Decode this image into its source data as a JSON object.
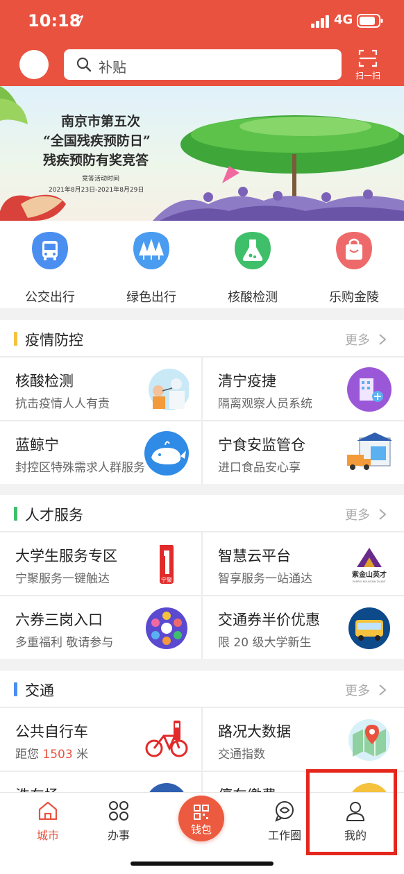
{
  "status_bar": {
    "time": "10:18",
    "network": "4G"
  },
  "search": {
    "placeholder": "补贴"
  },
  "scan": {
    "label": "扫一扫"
  },
  "banner": {
    "line1": "南京市第五次",
    "line2": "“全国残疾预防日”",
    "line3": "残疾预防有奖竞答",
    "line4": "竞答活动时间",
    "line5": "2021年8月23日-2021年8月29日"
  },
  "quick_entries": [
    {
      "label": "公交出行",
      "icon": "bus-icon",
      "color": "#4a8ef0"
    },
    {
      "label": "绿色出行",
      "icon": "trees-icon",
      "color": "#4a9cf0"
    },
    {
      "label": "核酸检测",
      "icon": "flask-icon",
      "color": "#3fbf6a"
    },
    {
      "label": "乐购金陵",
      "icon": "shopping-bag-icon",
      "color": "#ee6a6a"
    }
  ],
  "sections": [
    {
      "title": "疫情防控",
      "more": "更多",
      "bar_color": "#f5c23d",
      "cards": [
        {
          "title": "核酸检测",
          "subtitle": "抗击疫情人人有责",
          "icon": "swab-test-icon"
        },
        {
          "title": "清宁疫捷",
          "subtitle": "隔离观察人员系统",
          "icon": "hotel-icon"
        },
        {
          "title": "蓝鲸宁",
          "subtitle": "封控区特殊需求人群服务",
          "icon": "whale-icon"
        },
        {
          "title": "宁食安监管仓",
          "subtitle": "进口食品安心享",
          "icon": "warehouse-truck-icon"
        }
      ]
    },
    {
      "title": "人才服务",
      "more": "更多",
      "bar_color": "#3fbf6a",
      "cards": [
        {
          "title": "大学生服务专区",
          "subtitle": "宁聚服务一键触达",
          "icon": "ningju-logo-icon",
          "logo_text": "宁聚"
        },
        {
          "title": "智慧云平台",
          "subtitle": "智享服务一站通达",
          "icon": "zijinshan-logo-icon",
          "logo_text": "紫金山英才",
          "logo_sub": "PURPLE MOUNTAIN TALENT"
        },
        {
          "title": "六券三岗入口",
          "subtitle": "多重福利 敬请参与",
          "icon": "coupons-icon"
        },
        {
          "title": "交通券半价优惠",
          "subtitle": "限 20 级大学新生",
          "icon": "bus-front-icon"
        }
      ]
    },
    {
      "title": "交通",
      "more": "更多",
      "bar_color": "#4a8ef0",
      "cards": [
        {
          "title": "公共自行车",
          "subtitle_prefix": "距您",
          "subtitle_value": "1503",
          "subtitle_suffix": "米",
          "icon": "bicycle-icon"
        },
        {
          "title": "路况大数据",
          "subtitle": "交通指数",
          "icon": "map-pin-icon"
        },
        {
          "title": "洗车场",
          "subtitle": "",
          "icon": "car-wash-icon"
        },
        {
          "title": "停车缴费",
          "subtitle": "",
          "icon": "parking-icon"
        }
      ]
    }
  ],
  "tabbar": {
    "items": [
      {
        "label": "城市",
        "icon": "home-icon",
        "active": true
      },
      {
        "label": "办事",
        "icon": "grid-clover-icon",
        "active": false
      },
      {
        "label": "钱包",
        "icon": "qr-wallet-icon",
        "active": false
      },
      {
        "label": "工作圈",
        "icon": "chat-circle-icon",
        "active": false
      },
      {
        "label": "我的",
        "icon": "person-icon",
        "active": false
      }
    ]
  },
  "colors": {
    "brand": "#e9523f",
    "highlight": "#e5261c"
  }
}
